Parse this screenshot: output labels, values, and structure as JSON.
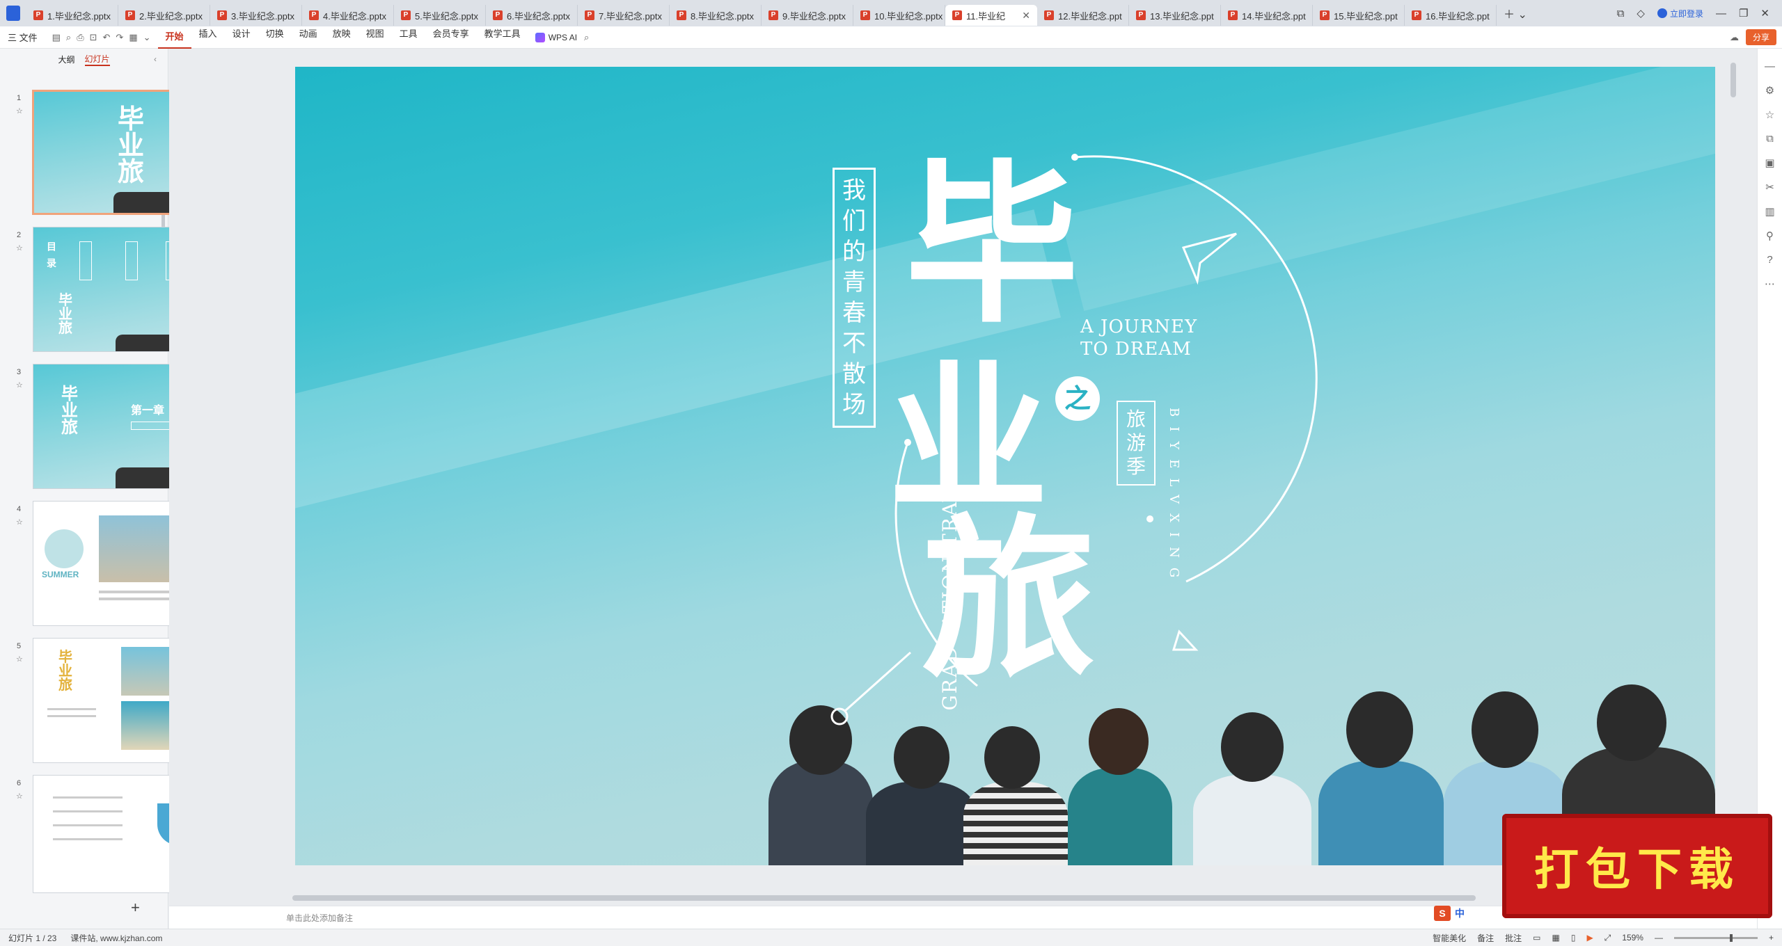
{
  "tabs": [
    "1.毕业纪念.pptx",
    "2.毕业纪念.pptx",
    "3.毕业纪念.pptx",
    "4.毕业纪念.pptx",
    "5.毕业纪念.pptx",
    "6.毕业纪念.pptx",
    "7.毕业纪念.pptx",
    "8.毕业纪念.pptx",
    "9.毕业纪念.pptx",
    "10.毕业纪念.pptx",
    "11.毕业纪",
    "12.毕业纪念.ppt",
    "13.毕业纪念.ppt",
    "14.毕业纪念.ppt",
    "15.毕业纪念.ppt",
    "16.毕业纪念.ppt"
  ],
  "login_label": "立即登录",
  "ribbon": {
    "file": "三 文件",
    "items": [
      "开始",
      "插入",
      "设计",
      "切换",
      "动画",
      "放映",
      "视图",
      "工具",
      "会员专享",
      "教学工具"
    ],
    "wps_ai": "WPS AI",
    "share": "分享"
  },
  "panel": {
    "outline": "大纲",
    "slides": "幻灯片"
  },
  "slide_numbers": [
    "1",
    "2",
    "3",
    "4",
    "5",
    "6"
  ],
  "thumbs": {
    "t2_label": "目录",
    "t3_chapter": "第一章",
    "t4_summer": "SUMMER"
  },
  "slide": {
    "vertical_box": "我们的青春不散场",
    "big1": "毕",
    "big2": "业",
    "big3": "旅",
    "zhi": "之",
    "eng1": "A JOURNEY",
    "eng2": "TO DREAM",
    "season": "旅游季",
    "grad": "GRADUATION TRAVEL",
    "pinyin": "BIYELVXING"
  },
  "notes_placeholder": "单击此处添加备注",
  "status": {
    "slide_counter": "幻灯片 1 / 23",
    "site": "课件站, www.kjzhan.com",
    "beautify": "智能美化",
    "notes": "备注",
    "comments": "批注",
    "zoom": "159%"
  },
  "promo": "打包下载",
  "ime": "中"
}
